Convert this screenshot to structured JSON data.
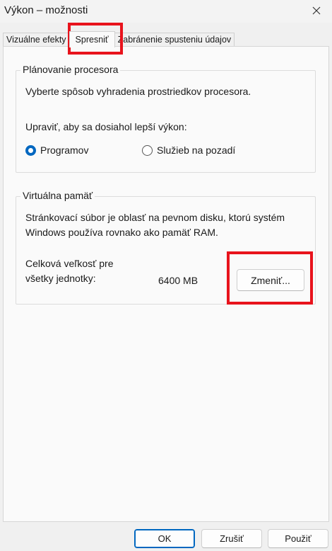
{
  "window": {
    "title": "Výkon – možnosti"
  },
  "tabs": [
    {
      "label": "Vizuálne efekty"
    },
    {
      "label": "Spresniť"
    },
    {
      "label": "Zabránenie spusteniu údajov"
    }
  ],
  "processor": {
    "legend": "Plánovanie procesora",
    "description": "Vyberte spôsob vyhradenia prostriedkov procesora.",
    "adjust_label": "Upraviť, aby sa dosiahol lepší výkon:",
    "options": [
      {
        "label": "Programov",
        "checked": true
      },
      {
        "label": "Služieb na pozadí",
        "checked": false
      }
    ]
  },
  "virtual_memory": {
    "legend": "Virtuálna pamäť",
    "description_line1": "Stránkovací súbor je oblasť na pevnom disku, ktorú systém",
    "description_line2": "Windows používa rovnako ako pamäť RAM.",
    "total_label_line1": "Celková veľkosť pre",
    "total_label_line2": "všetky jednotky:",
    "total_value": "6400 MB",
    "change_label": "Zmeniť..."
  },
  "footer": {
    "ok_label": "OK",
    "cancel_label": "Zrušiť",
    "apply_label": "Použiť"
  },
  "colors": {
    "highlight": "#e8131c",
    "accent": "#0067c0"
  }
}
